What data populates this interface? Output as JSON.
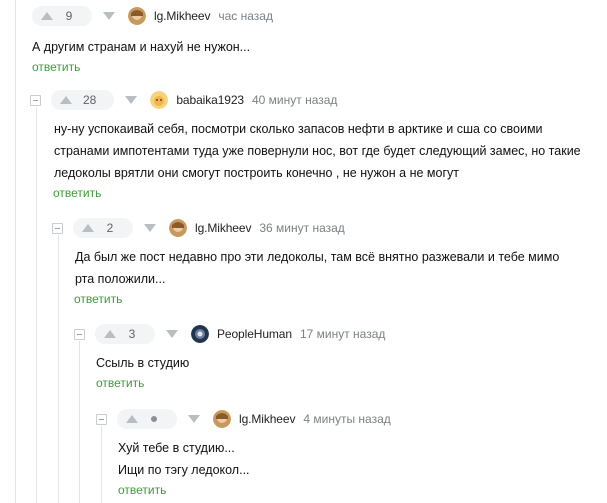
{
  "comments": [
    {
      "rating": "9",
      "author": "lg.Mikheev",
      "time": "час назад",
      "body_lines": [
        "А другим странам и нахуй не нужон..."
      ],
      "reply": "ответить",
      "avatar": "avatar-lg-mikheev"
    },
    {
      "rating": "28",
      "author": "babaika1923",
      "time": "40 минут назад",
      "body_lines": [
        "ну-ну успокаивай себя, посмотри сколько запасов нефти в арктике и сша со своими",
        "странами импотентами туда уже повернули нос, вот где будет следующий замес, но такие",
        "ледоколы врятли они смогут построить конечно , не нужон а не могут"
      ],
      "reply": "ответить",
      "avatar": "avatar-babaika1923"
    },
    {
      "rating": "2",
      "author": "lg.Mikheev",
      "time": "36 минут назад",
      "body_lines": [
        "Да был же пост недавно про эти ледоколы, там всё внятно разжевали и тебе мимо",
        "рта положили..."
      ],
      "reply": "ответить",
      "avatar": "avatar-lg-mikheev"
    },
    {
      "rating": "3",
      "author": "PeopleHuman",
      "time": "17 минут назад",
      "body_lines": [
        "Ссыль в студию"
      ],
      "reply": "ответить",
      "avatar": "avatar-peoplehuman"
    },
    {
      "rating": "",
      "author": "lg.Mikheev",
      "time": "4 минуты назад",
      "body_lines": [
        "Хуй тебе в студию...",
        "Ищи по тэгу ледокол..."
      ],
      "reply": "ответить",
      "avatar": "avatar-lg-mikheev"
    }
  ],
  "colors": {
    "reply_link": "#3d9c3b",
    "rating_bg": "#f3f4f5",
    "thread_line": "#e3e6e9",
    "meta_text": "#7b8086"
  },
  "icons": [
    "arrow-up-icon",
    "arrow-down-icon",
    "collapse-icon",
    "neutral-dot-icon"
  ]
}
